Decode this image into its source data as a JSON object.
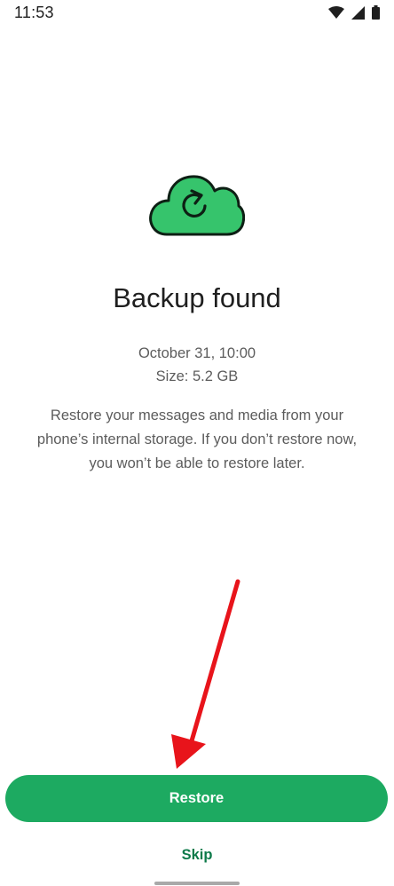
{
  "status_bar": {
    "time": "11:53",
    "icons": [
      "wifi-icon",
      "signal-icon",
      "battery-icon"
    ]
  },
  "illustration": {
    "icon": "cloud-restore-icon",
    "fill_color": "#36c46c",
    "stroke_color": "#0d1f14"
  },
  "backup": {
    "title": "Backup found",
    "date": "October 31, 10:00",
    "size": "Size: 5.2 GB",
    "description": "Restore your messages and media from your phone’s internal storage. If you don’t restore now, you won’t be able to restore later."
  },
  "actions": {
    "restore_label": "Restore",
    "skip_label": "Skip"
  },
  "annotation": {
    "icon": "red-arrow-icon",
    "color": "#e8141b"
  },
  "colors": {
    "primary_button": "#1daa61",
    "link": "#0d7a4a",
    "text": "#1f1f1f",
    "secondary_text": "#5c5c5c"
  }
}
